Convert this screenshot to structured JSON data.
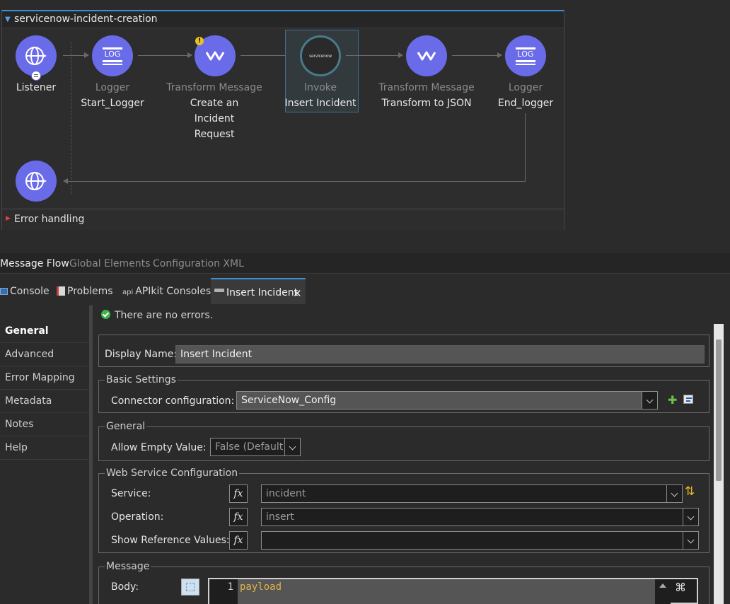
{
  "flow": {
    "title": "servicenow-incident-creation",
    "nodes": [
      {
        "type": "Listener",
        "name": ""
      },
      {
        "type": "Logger",
        "name": "Start_Logger"
      },
      {
        "type": "Transform Message",
        "name": "Create an Incident Request"
      },
      {
        "type": "Invoke",
        "name": "Insert Incident"
      },
      {
        "type": "Transform Message",
        "name": "Transform to JSON"
      },
      {
        "type": "Logger",
        "name": "End_logger"
      }
    ],
    "logger_icon_text": "LOG",
    "servicenow_logo_text": "servicenow",
    "error_handling": "Error handling"
  },
  "editor_tabs": [
    "Message Flow",
    "Global Elements",
    "Configuration XML"
  ],
  "view_tabs": {
    "console": "Console",
    "problems": "Problems",
    "apikit": "APIkit Consoles",
    "apikit_prefix": "api",
    "insert": "Insert Incident"
  },
  "nav": [
    "General",
    "Advanced",
    "Error Mapping",
    "Metadata",
    "Notes",
    "Help"
  ],
  "status": "There are no errors.",
  "form": {
    "display_name_label": "Display Name:",
    "display_name_value": "Insert Incident",
    "basic_settings": "Basic Settings",
    "connector_label": "Connector configuration:",
    "connector_value": "ServiceNow_Config",
    "general": "General",
    "allow_empty_label": "Allow Empty Value:",
    "allow_empty_value": "False (Default)",
    "ws_config": "Web Service Configuration",
    "service_label": "Service:",
    "service_value": "incident",
    "operation_label": "Operation:",
    "operation_value": "insert",
    "show_ref_label": "Show Reference Values:",
    "show_ref_value": "",
    "fx": "fx",
    "message": "Message",
    "body_label": "Body:",
    "body_line": "1",
    "body_code": "payload"
  },
  "colors": {
    "node": "#6a6be8",
    "accent": "#3a8fd6",
    "code": "#e0b24a"
  }
}
